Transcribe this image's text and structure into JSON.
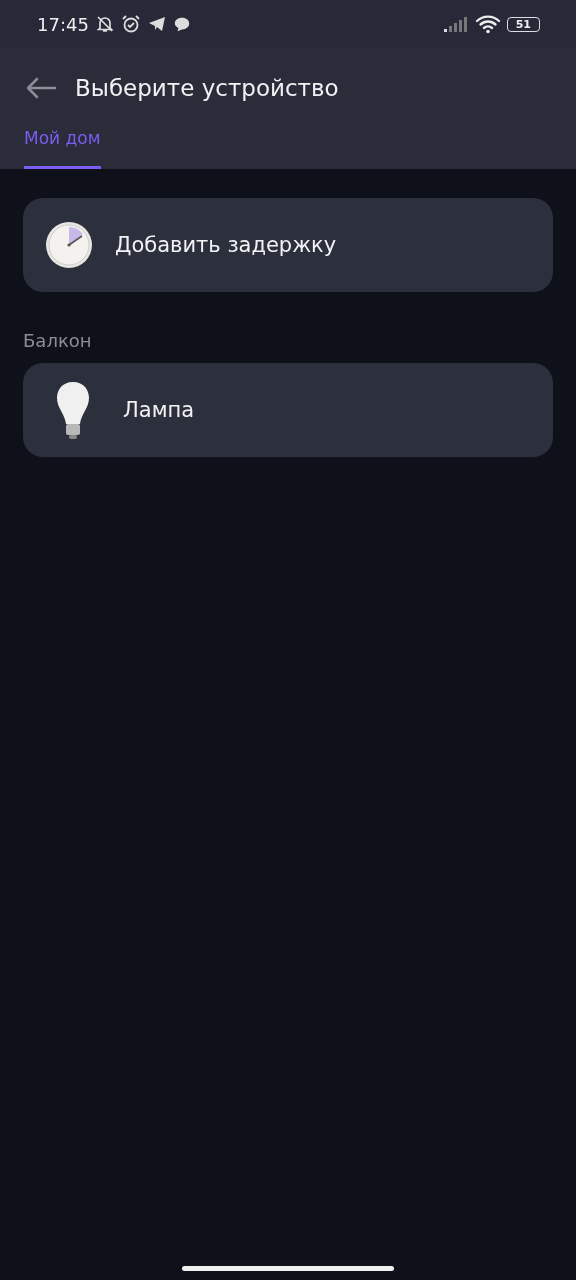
{
  "status_bar": {
    "time": "17:45",
    "battery": "51"
  },
  "header": {
    "title": "Выберите устройство"
  },
  "tabs": [
    {
      "label": "Мой дом",
      "selected": true
    }
  ],
  "actions": [
    {
      "kind": "delay",
      "label": "Добавить задержку"
    }
  ],
  "groups": [
    {
      "title": "Балкон",
      "items": [
        {
          "kind": "lamp",
          "label": "Лампа"
        }
      ]
    }
  ]
}
